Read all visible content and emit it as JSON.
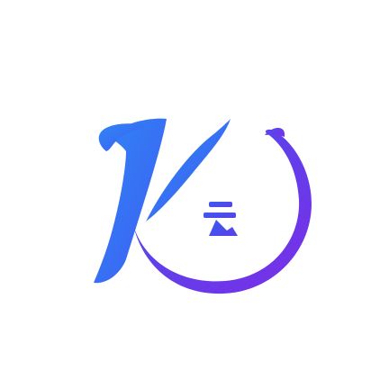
{
  "logo": {
    "letter": "K",
    "character": "云",
    "colors": {
      "gradient_start": "#2f86f6",
      "gradient_mid": "#3f5cf2",
      "gradient_end": "#7a2ee6",
      "background": "#ffffff"
    }
  }
}
